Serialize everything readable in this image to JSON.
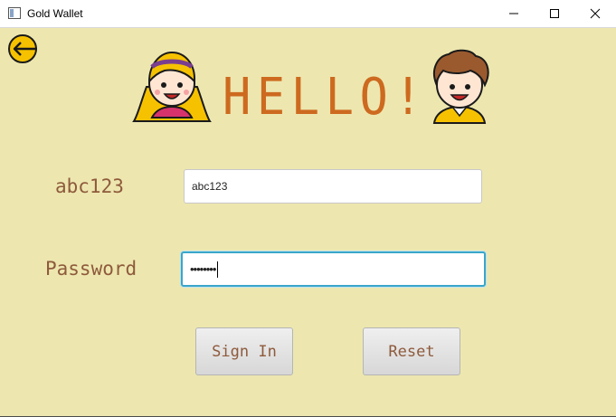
{
  "window": {
    "title": "Gold Wallet"
  },
  "header": {
    "greeting": "HELLO!"
  },
  "form": {
    "username_label": "abc123",
    "username_value": "abc123",
    "password_label": "Password",
    "password_masked": "••••••••"
  },
  "actions": {
    "sign_in_label": "Sign In",
    "reset_label": "Reset"
  },
  "icons": {
    "back": "back-arrow-icon",
    "girl": "girl-avatar-icon",
    "boy": "boy-avatar-icon"
  },
  "colors": {
    "background": "#EDE7AF",
    "greeting": "#CD6A1F",
    "label_text": "#8E5A3C",
    "focus_border": "#3AA6C9"
  }
}
